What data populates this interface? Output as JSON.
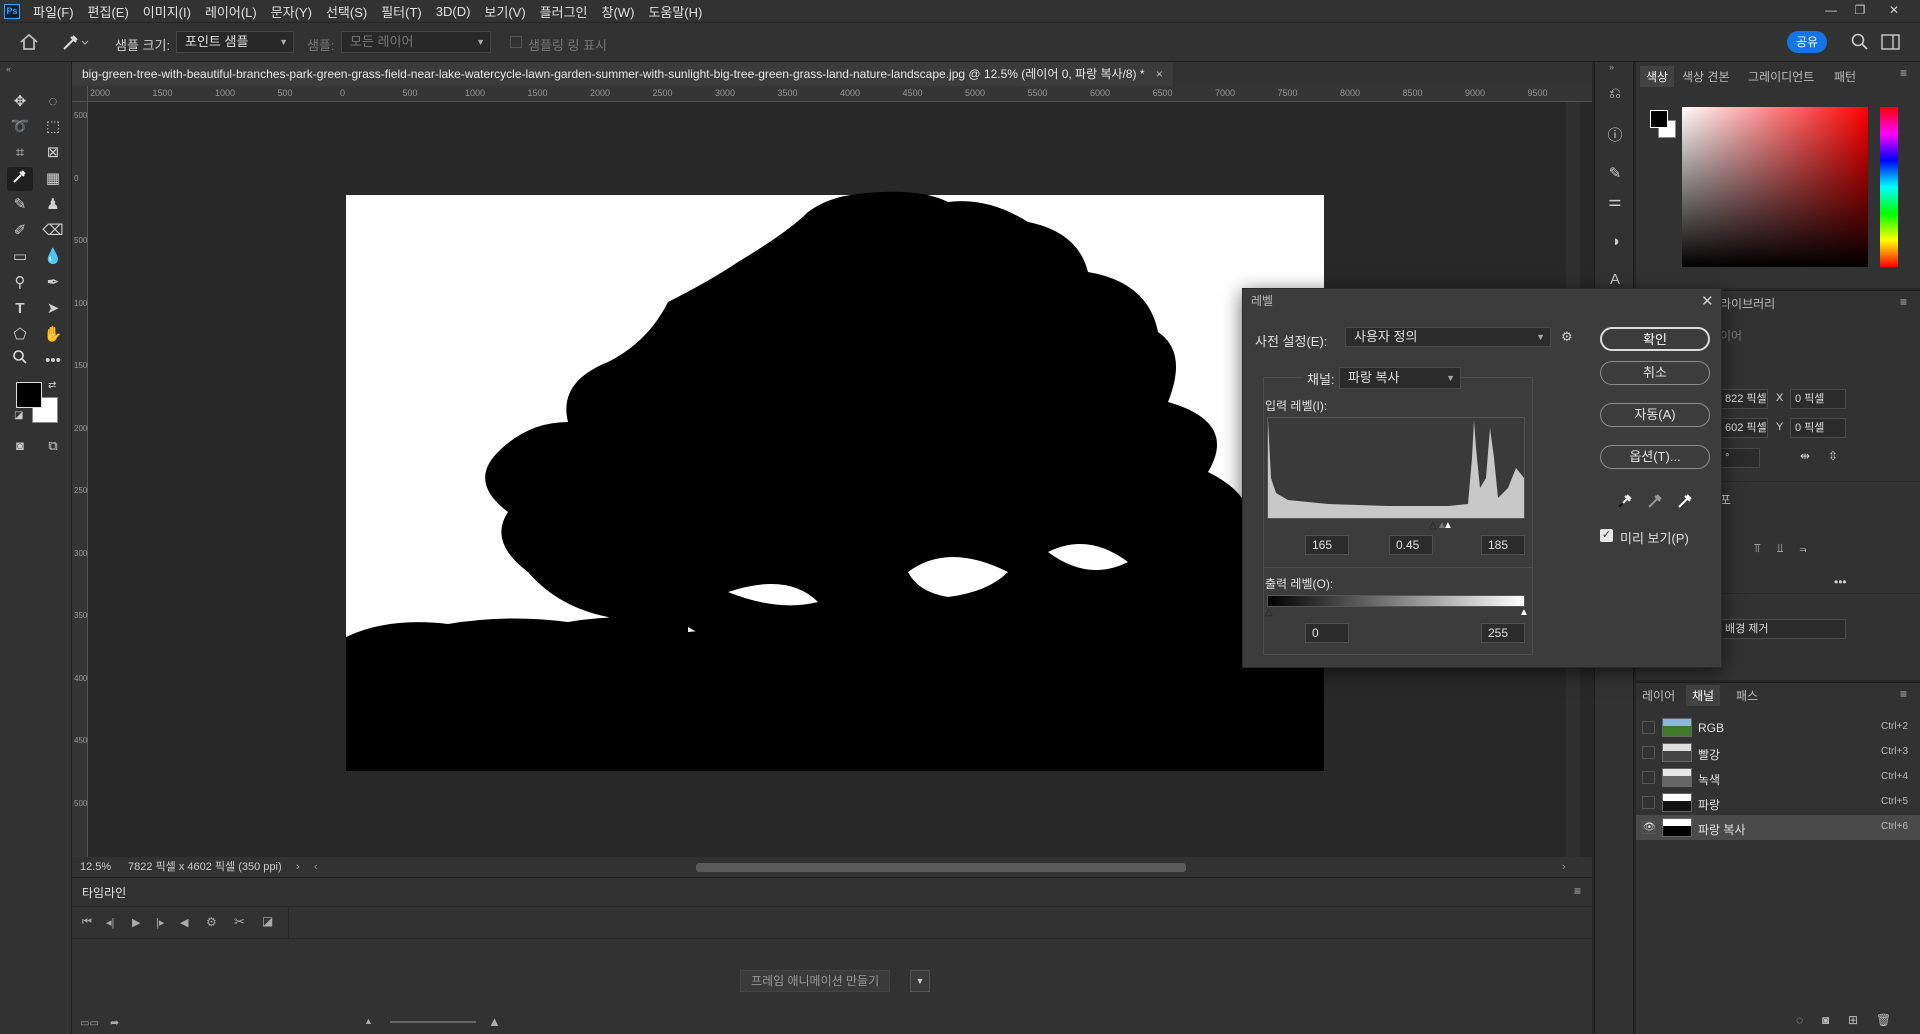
{
  "menubar": {
    "logo": "Ps",
    "items": [
      "파일(F)",
      "편집(E)",
      "이미지(I)",
      "레이어(L)",
      "문자(Y)",
      "선택(S)",
      "필터(T)",
      "3D(D)",
      "보기(V)",
      "플러그인",
      "창(W)",
      "도움말(H)"
    ],
    "window_controls": [
      "—",
      "❐",
      "✕"
    ]
  },
  "options": {
    "sample_size_label": "샘플 크기:",
    "sample_size_value": "포인트 샘플",
    "sample_label": "샘플:",
    "sample_value": "모든 레이어",
    "show_ring_label": "샘플링 링 표시",
    "share_label": "공유"
  },
  "document": {
    "tab_title": "big-green-tree-with-beautiful-branches-park-green-grass-field-near-lake-watercycle-lawn-garden-summer-with-sunlight-big-tree-green-grass-land-nature-landscape.jpg @ 12.5% (레이어 0, 파랑 복사/8) *",
    "ruler_h": [
      "2000",
      "1500",
      "1000",
      "500",
      "0",
      "500",
      "1000",
      "1500",
      "2000",
      "2500",
      "3000",
      "3500",
      "4000",
      "4500",
      "5000",
      "5500",
      "6000",
      "6500",
      "7000",
      "7500",
      "8000",
      "8500",
      "9000",
      "9500"
    ],
    "ruler_v": [
      "5 0 0",
      "0",
      "5 0 0",
      "1 0 0 0",
      "1 5 0 0",
      "2 0 0 0",
      "2 5 0 0",
      "3 0 0 0",
      "3 5 0 0",
      "4 0 0 0",
      "4 5 0 0",
      "5 0 0 0"
    ]
  },
  "status": {
    "zoom": "12.5%",
    "dimensions": "7822 픽셀 x 4602 픽셀 (350 ppi)"
  },
  "timeline": {
    "title": "타임라인",
    "create_button": "프레임 애니메이션 만들기"
  },
  "color_panel": {
    "tabs": [
      "색상",
      "색상 견본",
      "그레이디언트",
      "패턴"
    ],
    "hue_color": "#ff0000"
  },
  "library_panel": {
    "tab": "라이브러리",
    "partial_label": "이어",
    "w_value": "822 픽셀",
    "h_value": "602 픽셀",
    "x_label": "X",
    "x_value": "0 픽셀",
    "y_label": "Y",
    "y_value": "0 픽셀",
    "angle_value": "°",
    "partial_label2": "포",
    "remove_bg": "배경 제거"
  },
  "channels_panel": {
    "tabs": [
      "레이어",
      "채널",
      "패스"
    ],
    "rows": [
      {
        "name": "RGB",
        "shortcut": "Ctrl+2"
      },
      {
        "name": "빨강",
        "shortcut": "Ctrl+3"
      },
      {
        "name": "녹색",
        "shortcut": "Ctrl+4"
      },
      {
        "name": "파랑",
        "shortcut": "Ctrl+5"
      },
      {
        "name": "파랑 복사",
        "shortcut": "Ctrl+6"
      }
    ]
  },
  "levels_dialog": {
    "title": "레벨",
    "preset_label": "사전 설정(E):",
    "preset_value": "사용자 정의",
    "channel_label": "채널:",
    "channel_value": "파랑 복사",
    "input_label": "입력 레벨(I):",
    "input_black": "165",
    "input_gamma": "0.45",
    "input_white": "185",
    "output_label": "출력 레벨(O):",
    "output_black": "0",
    "output_white": "255",
    "ok": "확인",
    "cancel": "취소",
    "auto": "자동(A)",
    "options": "옵션(T)...",
    "preview": "미리 보기(P)"
  }
}
